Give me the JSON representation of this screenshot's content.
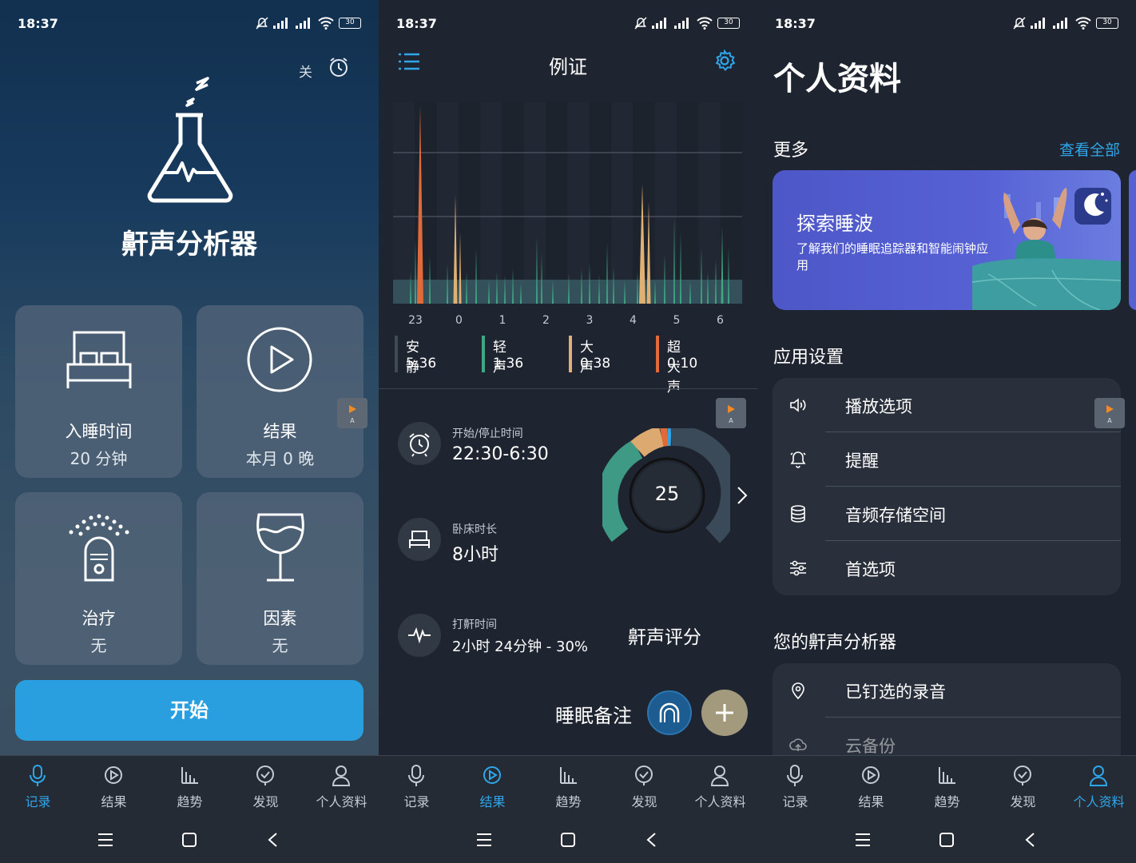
{
  "status": {
    "time": "18:37",
    "battery": "30"
  },
  "screen1": {
    "alarm_state": "关",
    "app_title": "鼾声分析器",
    "cards": [
      {
        "title": "入睡时间",
        "value": "20 分钟"
      },
      {
        "title": "结果",
        "value": "本月 0 晚"
      },
      {
        "title": "治疗",
        "value": "无"
      },
      {
        "title": "因素",
        "value": "无"
      }
    ],
    "start_label": "开始"
  },
  "screen2": {
    "title": "例证",
    "chart_data": {
      "type": "bar",
      "x_ticks": [
        "23",
        "0",
        "1",
        "2",
        "3",
        "4",
        "5",
        "6"
      ],
      "legend": [
        {
          "name": "安静",
          "value": "5:36",
          "color": "#3f4a55"
        },
        {
          "name": "轻声",
          "value": "1:36",
          "color": "#3ea882"
        },
        {
          "name": "大声",
          "value": "0:38",
          "color": "#e0b173"
        },
        {
          "name": "超大声",
          "value": "0:10",
          "color": "#e06a3a"
        }
      ]
    },
    "start_stop_label": "开始/停止时间",
    "start_stop_value": "22:30-6:30",
    "bed_label": "卧床时长",
    "bed_value": "8小时",
    "snore_label": "打鼾时间",
    "snore_value": "2小时 24分钟 - 30%",
    "score": "25",
    "score_label": "鼾声评分",
    "notes_label": "睡眠备注"
  },
  "screen3": {
    "title": "个人资料",
    "more_label": "更多",
    "see_all": "查看全部",
    "banner_title": "探索睡波",
    "banner_desc": "了解我们的睡眠追踪器和智能闹钟应用",
    "settings_header": "应用设置",
    "settings": [
      "播放选项",
      "提醒",
      "音频存储空间",
      "首选项"
    ],
    "yours_header": "您的鼾声分析器",
    "yours": [
      "已钉选的录音",
      "云备份"
    ]
  },
  "tabs": [
    "记录",
    "结果",
    "趋势",
    "发现",
    "个人资料"
  ],
  "colors": {
    "accent": "#2fa6ea",
    "button": "#2a9fdf",
    "quiet": "#3f4a55",
    "light": "#3ea882",
    "loud": "#e0b173",
    "epic": "#e06a3a"
  }
}
